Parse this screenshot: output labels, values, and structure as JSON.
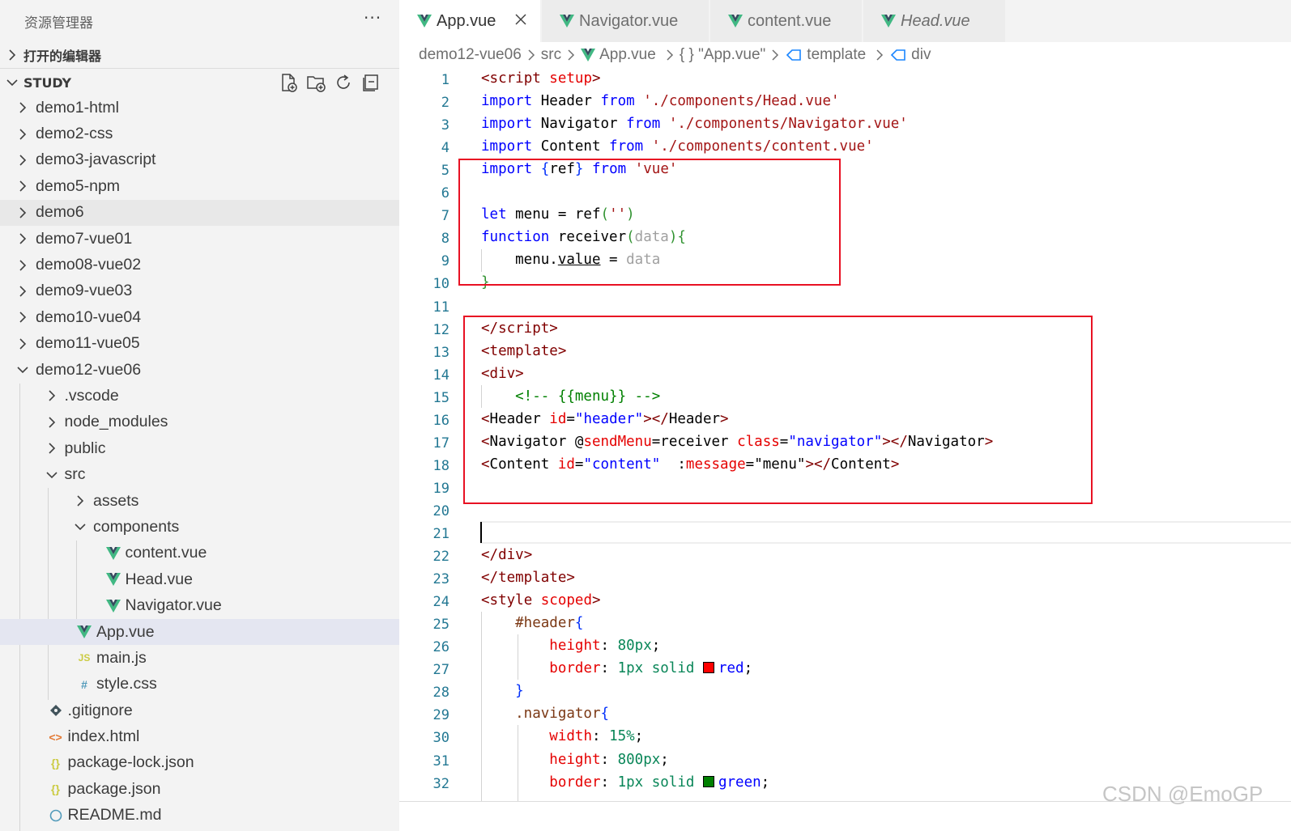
{
  "sidebar": {
    "title": "资源管理器",
    "more": "···",
    "open_editors": "打开的编辑器",
    "workspace": "STUDY",
    "tree": [
      {
        "label": "demo1-html",
        "depth": 0,
        "kind": "folder",
        "open": false
      },
      {
        "label": "demo2-css",
        "depth": 0,
        "kind": "folder",
        "open": false
      },
      {
        "label": "demo3-javascript",
        "depth": 0,
        "kind": "folder",
        "open": false
      },
      {
        "label": "demo5-npm",
        "depth": 0,
        "kind": "folder",
        "open": false
      },
      {
        "label": "demo6",
        "depth": 0,
        "kind": "folder",
        "open": false,
        "hover": true
      },
      {
        "label": "demo7-vue01",
        "depth": 0,
        "kind": "folder",
        "open": false
      },
      {
        "label": "demo08-vue02",
        "depth": 0,
        "kind": "folder",
        "open": false
      },
      {
        "label": "demo9-vue03",
        "depth": 0,
        "kind": "folder",
        "open": false
      },
      {
        "label": "demo10-vue04",
        "depth": 0,
        "kind": "folder",
        "open": false
      },
      {
        "label": "demo11-vue05",
        "depth": 0,
        "kind": "folder",
        "open": false
      },
      {
        "label": "demo12-vue06",
        "depth": 0,
        "kind": "folder",
        "open": true
      },
      {
        "label": ".vscode",
        "depth": 1,
        "kind": "folder",
        "open": false
      },
      {
        "label": "node_modules",
        "depth": 1,
        "kind": "folder",
        "open": false
      },
      {
        "label": "public",
        "depth": 1,
        "kind": "folder",
        "open": false
      },
      {
        "label": "src",
        "depth": 1,
        "kind": "folder",
        "open": true
      },
      {
        "label": "assets",
        "depth": 2,
        "kind": "folder",
        "open": false
      },
      {
        "label": "components",
        "depth": 2,
        "kind": "folder",
        "open": true
      },
      {
        "label": "content.vue",
        "depth": 3,
        "kind": "vue"
      },
      {
        "label": "Head.vue",
        "depth": 3,
        "kind": "vue"
      },
      {
        "label": "Navigator.vue",
        "depth": 3,
        "kind": "vue"
      },
      {
        "label": "App.vue",
        "depth": 2,
        "kind": "vue",
        "selected": true
      },
      {
        "label": "main.js",
        "depth": 2,
        "kind": "js",
        "icon": "JS"
      },
      {
        "label": "style.css",
        "depth": 2,
        "kind": "css",
        "icon": "#"
      },
      {
        "label": ".gitignore",
        "depth": 1,
        "kind": "git"
      },
      {
        "label": "index.html",
        "depth": 1,
        "kind": "html",
        "icon": "<>"
      },
      {
        "label": "package-lock.json",
        "depth": 1,
        "kind": "json",
        "icon": "{}"
      },
      {
        "label": "package.json",
        "depth": 1,
        "kind": "json",
        "icon": "{}"
      },
      {
        "label": "README.md",
        "depth": 1,
        "kind": "info"
      }
    ]
  },
  "tabs": [
    {
      "label": "App.vue",
      "active": true,
      "italic": false
    },
    {
      "label": "Navigator.vue",
      "active": false,
      "italic": false
    },
    {
      "label": "content.vue",
      "active": false,
      "italic": false
    },
    {
      "label": "Head.vue",
      "active": false,
      "italic": true
    }
  ],
  "breadcrumb": [
    "demo12-vue06",
    "src",
    "App.vue",
    "{ } \"App.vue\"",
    "template",
    "div"
  ],
  "code_lines": [
    [
      [
        "<",
        "t"
      ],
      [
        "script",
        "t"
      ],
      [
        " setup",
        "a"
      ],
      [
        ">",
        "t"
      ]
    ],
    [
      [
        "import",
        "k"
      ],
      [
        " Header ",
        ""
      ],
      [
        "from",
        "k"
      ],
      [
        " './components/Head.vue'",
        "s"
      ]
    ],
    [
      [
        "import",
        "k"
      ],
      [
        " Navigator ",
        ""
      ],
      [
        "from",
        "k"
      ],
      [
        " './components/Navigator.vue'",
        "s"
      ]
    ],
    [
      [
        "import",
        "k"
      ],
      [
        " Content ",
        ""
      ],
      [
        "from",
        "k"
      ],
      [
        " './components/content.vue'",
        "s"
      ]
    ],
    [
      [
        "import",
        "k"
      ],
      [
        " ",
        ""
      ],
      [
        "{",
        "b1"
      ],
      [
        "ref",
        ""
      ],
      [
        "}",
        "b1"
      ],
      [
        " ",
        ""
      ],
      [
        "from",
        "k"
      ],
      [
        " 'vue'",
        "s"
      ]
    ],
    [],
    [
      [
        "let",
        "k"
      ],
      [
        " menu = ref",
        ""
      ],
      [
        "(",
        "b2"
      ],
      [
        "''",
        "s"
      ],
      [
        ")",
        "b2"
      ]
    ],
    [
      [
        "function",
        "k"
      ],
      [
        " receiver",
        ""
      ],
      [
        "(",
        "b2"
      ],
      [
        "data",
        "p"
      ],
      [
        ")",
        "b2"
      ],
      [
        "{",
        "b2"
      ]
    ],
    [
      [
        "    menu.",
        ""
      ],
      [
        "value",
        "u"
      ],
      [
        " = ",
        ""
      ],
      [
        "data",
        "p"
      ]
    ],
    [
      [
        "}",
        "b2"
      ]
    ],
    [],
    [
      [
        "</",
        "t"
      ],
      [
        "script",
        "t"
      ],
      [
        ">",
        "t"
      ]
    ],
    [
      [
        "<",
        "t"
      ],
      [
        "template",
        "t"
      ],
      [
        ">",
        "t"
      ]
    ],
    [
      [
        "<",
        "t"
      ],
      [
        "div",
        "t"
      ],
      [
        ">",
        "t"
      ]
    ],
    [
      [
        "    <!-- {{menu}} -->",
        "c"
      ]
    ],
    [
      [
        "<",
        "t"
      ],
      [
        "Header",
        ""
      ],
      [
        " id",
        "a"
      ],
      [
        "=",
        ""
      ],
      [
        "\"header\"",
        "v"
      ],
      [
        "></",
        "t"
      ],
      [
        "Header",
        ""
      ],
      [
        ">",
        "t"
      ]
    ],
    [
      [
        "<",
        "t"
      ],
      [
        "Navigator",
        ""
      ],
      [
        " @",
        ""
      ],
      [
        "sendMenu",
        "a"
      ],
      [
        "=receiver ",
        ""
      ],
      [
        "class",
        "a"
      ],
      [
        "=",
        ""
      ],
      [
        "\"navigator\"",
        "v"
      ],
      [
        "></",
        "t"
      ],
      [
        "Navigator",
        ""
      ],
      [
        ">",
        "t"
      ]
    ],
    [
      [
        "<",
        "t"
      ],
      [
        "Content",
        ""
      ],
      [
        " id",
        "a"
      ],
      [
        "=",
        ""
      ],
      [
        "\"content\"",
        "v"
      ],
      [
        "  :",
        ""
      ],
      [
        "message",
        "a"
      ],
      [
        "=\"menu\"",
        ""
      ],
      [
        "></",
        "t"
      ],
      [
        "Content",
        ""
      ],
      [
        ">",
        "t"
      ]
    ],
    [],
    [],
    [],
    [
      [
        "</",
        "t"
      ],
      [
        "div",
        "t"
      ],
      [
        ">",
        "t"
      ]
    ],
    [
      [
        "</",
        "t"
      ],
      [
        "template",
        "t"
      ],
      [
        ">",
        "t"
      ]
    ],
    [
      [
        "<",
        "t"
      ],
      [
        "style",
        "t"
      ],
      [
        " scoped",
        "a"
      ],
      [
        ">",
        "t"
      ]
    ],
    [
      [
        "    #header",
        "b3"
      ],
      [
        "{",
        "b1"
      ]
    ],
    [
      [
        "        ",
        ""
      ],
      [
        "height",
        "a"
      ],
      [
        ": ",
        ""
      ],
      [
        "80px",
        "n"
      ],
      [
        ";",
        ""
      ]
    ],
    [
      [
        "        ",
        ""
      ],
      [
        "border",
        "a"
      ],
      [
        ": ",
        ""
      ],
      [
        "1px",
        "n"
      ],
      [
        " solid ",
        "n"
      ],
      [
        "#ff0000",
        "swatch"
      ],
      [
        "red",
        "v"
      ],
      [
        ";",
        ""
      ]
    ],
    [
      [
        "    ",
        ""
      ],
      [
        "}",
        "b1"
      ]
    ],
    [
      [
        "    .navigator",
        "b3"
      ],
      [
        "{",
        "b1"
      ]
    ],
    [
      [
        "        ",
        ""
      ],
      [
        "width",
        "a"
      ],
      [
        ": ",
        ""
      ],
      [
        "15%",
        "n"
      ],
      [
        ";",
        ""
      ]
    ],
    [
      [
        "        ",
        ""
      ],
      [
        "height",
        "a"
      ],
      [
        ": ",
        ""
      ],
      [
        "800px",
        "n"
      ],
      [
        ";",
        ""
      ]
    ],
    [
      [
        "        ",
        ""
      ],
      [
        "border",
        "a"
      ],
      [
        ": ",
        ""
      ],
      [
        "1px",
        "n"
      ],
      [
        " solid ",
        "n"
      ],
      [
        "#008000",
        "swatch"
      ],
      [
        "green",
        "v"
      ],
      [
        ";",
        ""
      ]
    ]
  ],
  "watermark": "CSDN @EmoGP",
  "colors": {
    "accent_vue": "#41b883",
    "highlight_box": "#e81123",
    "selected_row": "#e4e6f1",
    "line_number": "#237893"
  }
}
